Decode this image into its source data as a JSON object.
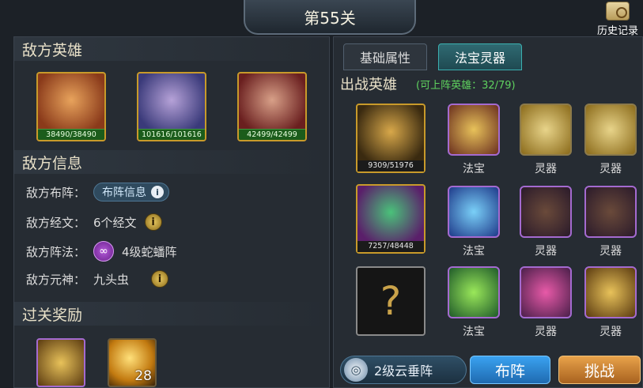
{
  "stage": {
    "title": "第55关"
  },
  "history": {
    "label": "历史记录"
  },
  "enemy_heroes": {
    "title": "敌方英雄",
    "heroes": [
      {
        "hp": "38490/38490"
      },
      {
        "hp": "101616/101616"
      },
      {
        "hp": "42499/42499"
      }
    ]
  },
  "enemy_info": {
    "title": "敌方信息",
    "formation_label": "敌方布阵：",
    "formation_button": "布阵信息",
    "scripture_label": "敌方经文：",
    "scripture_value": "6个经文",
    "array_label": "敌方阵法：",
    "array_value": "4级蛇蟠阵",
    "spirit_label": "敌方元神：",
    "spirit_value": "九头虫"
  },
  "rewards": {
    "title": "过关奖励",
    "items": [
      {
        "count": ""
      },
      {
        "count": "28"
      }
    ]
  },
  "tabs": [
    {
      "label": "基础属性"
    },
    {
      "label": "法宝灵器"
    }
  ],
  "battle": {
    "title": "出战英雄",
    "subtitle": "(可上阵英雄：32/79)",
    "rows": [
      {
        "hero_hp": "9309/51976",
        "items": [
          "法宝",
          "灵器",
          "灵器"
        ]
      },
      {
        "hero_hp": "7257/48448",
        "items": [
          "法宝",
          "灵器",
          "灵器"
        ]
      },
      {
        "hero_hp": "",
        "items": [
          "法宝",
          "灵器",
          "灵器"
        ]
      }
    ]
  },
  "bottom": {
    "formation": "2级云垂阵",
    "deploy": "布阵",
    "challenge": "挑战"
  },
  "colors": {
    "accent_green": "#5fd35f",
    "tab_active": "#3bb0b0",
    "challenge_orange": "#d8893a",
    "deploy_blue": "#2b8dd8"
  }
}
